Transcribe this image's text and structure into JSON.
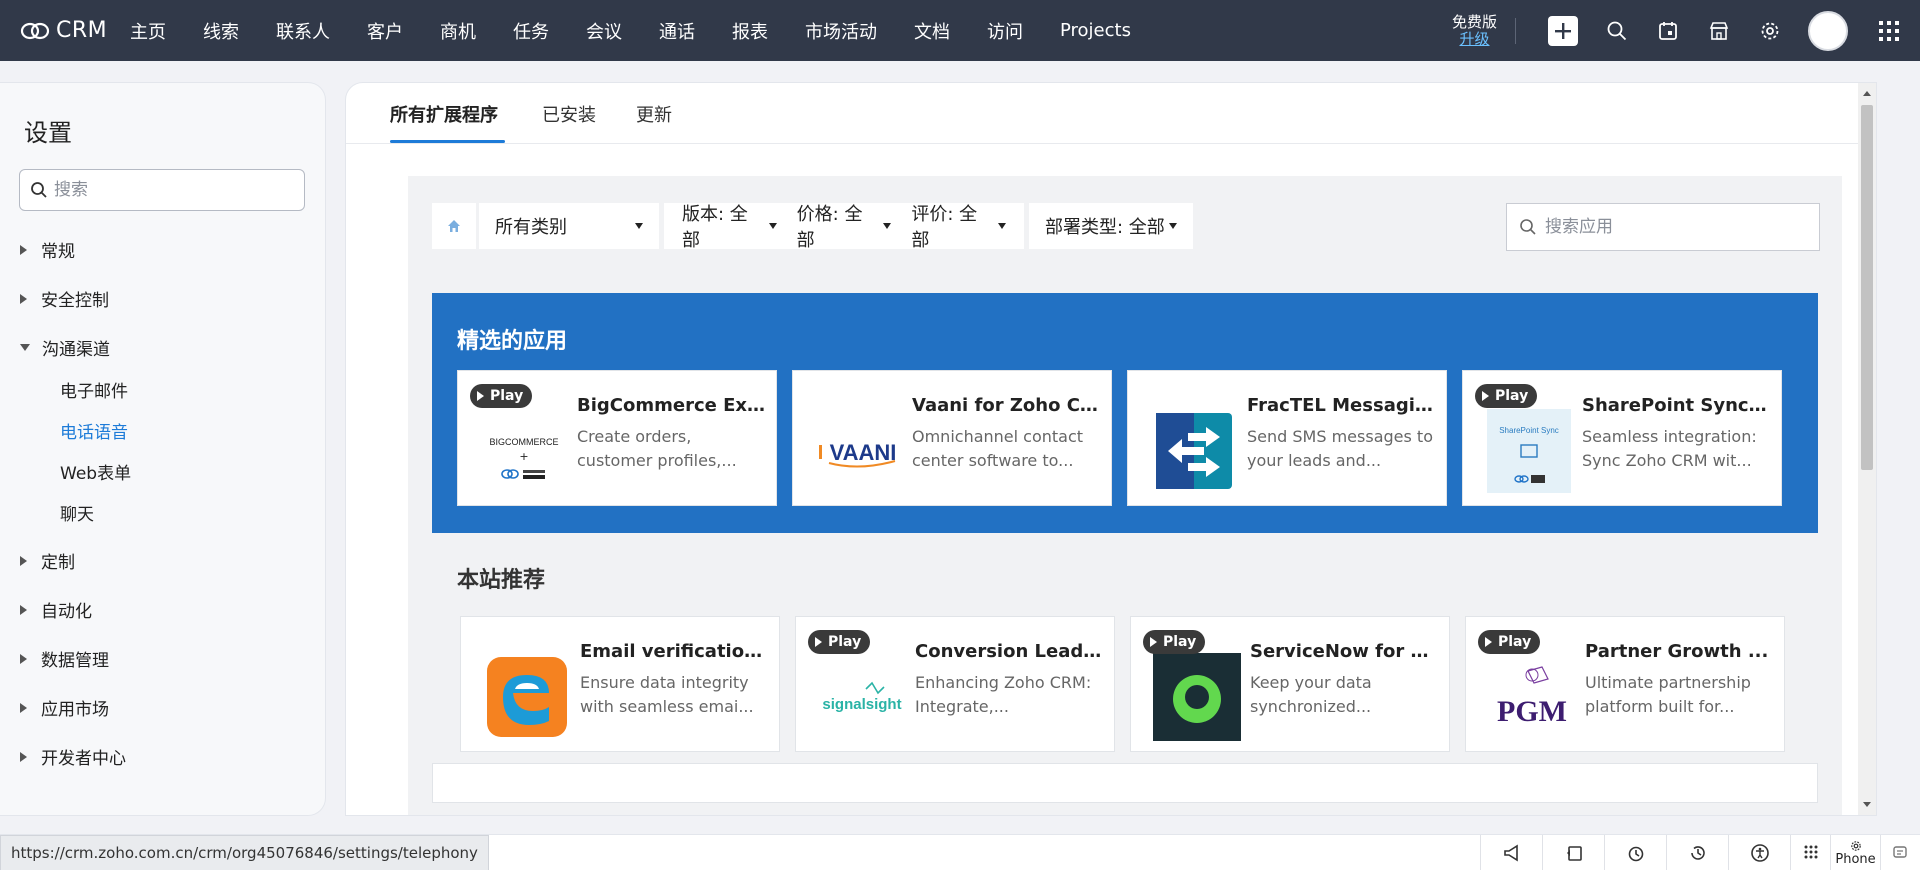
{
  "app": {
    "name": "CRM"
  },
  "nav": [
    "主页",
    "线索",
    "联系人",
    "客户",
    "商机",
    "任务",
    "会议",
    "通话",
    "报表",
    "市场活动",
    "文档",
    "访问",
    "Projects"
  ],
  "edition": {
    "label": "免费版",
    "upgrade": "升级"
  },
  "sidebar": {
    "title": "设置",
    "search_placeholder": "搜索",
    "sections": [
      "常规",
      "安全控制",
      "沟通渠道",
      "定制",
      "自动化",
      "数据管理",
      "应用市场",
      "开发者中心"
    ],
    "sub_items": [
      "电子邮件",
      "电话语音",
      "Web表单",
      "聊天"
    ]
  },
  "tabs": [
    "所有扩展程序",
    "已安装",
    "更新"
  ],
  "filters": {
    "category": "所有类别",
    "edition": "版本: 全部",
    "price": "价格: 全部",
    "rating": "评价: 全部",
    "deployment": "部署类型: 全部"
  },
  "app_search_placeholder": "搜索应用",
  "featured": {
    "title": "精选的应用",
    "cards": [
      {
        "name": "BigCommerce Ext...",
        "desc": "Create orders, customer profiles,...",
        "play": "Play",
        "logo_text": "BIGCOMMERCE"
      },
      {
        "name": "Vaani for Zoho C...",
        "desc": "Omnichannel contact center software to...",
        "logo_text": "VAANI"
      },
      {
        "name": "FracTEL Messagin...",
        "desc": "Send SMS messages to your leads and..."
      },
      {
        "name": "SharePoint Sync f...",
        "desc": "Seamless integration: Sync Zoho CRM wit...",
        "play": "Play",
        "logo_text": "SharePoint Sync"
      }
    ]
  },
  "recommended": {
    "title": "本站推荐",
    "cards": [
      {
        "name": "Email verification...",
        "desc": "Ensure data integrity with seamless emai..."
      },
      {
        "name": "Conversion Lead ...",
        "desc": "Enhancing Zoho CRM: Integrate,...",
        "play": "Play",
        "logo_text": "signalsight"
      },
      {
        "name": "ServiceNow for Z...",
        "desc": "Keep your data synchronized...",
        "play": "Play"
      },
      {
        "name": "Partner Growth ...",
        "desc": "Ultimate partnership platform built for...",
        "play": "Play",
        "logo_text": "PGM"
      }
    ]
  },
  "status": {
    "url": "https://crm.zoho.com.cn/crm/org45076846/settings/telephony",
    "phone_label": "Phone"
  },
  "colors": {
    "topbar": "#313949",
    "accent": "#1d7bd8",
    "featured_bg": "#2271c3"
  }
}
